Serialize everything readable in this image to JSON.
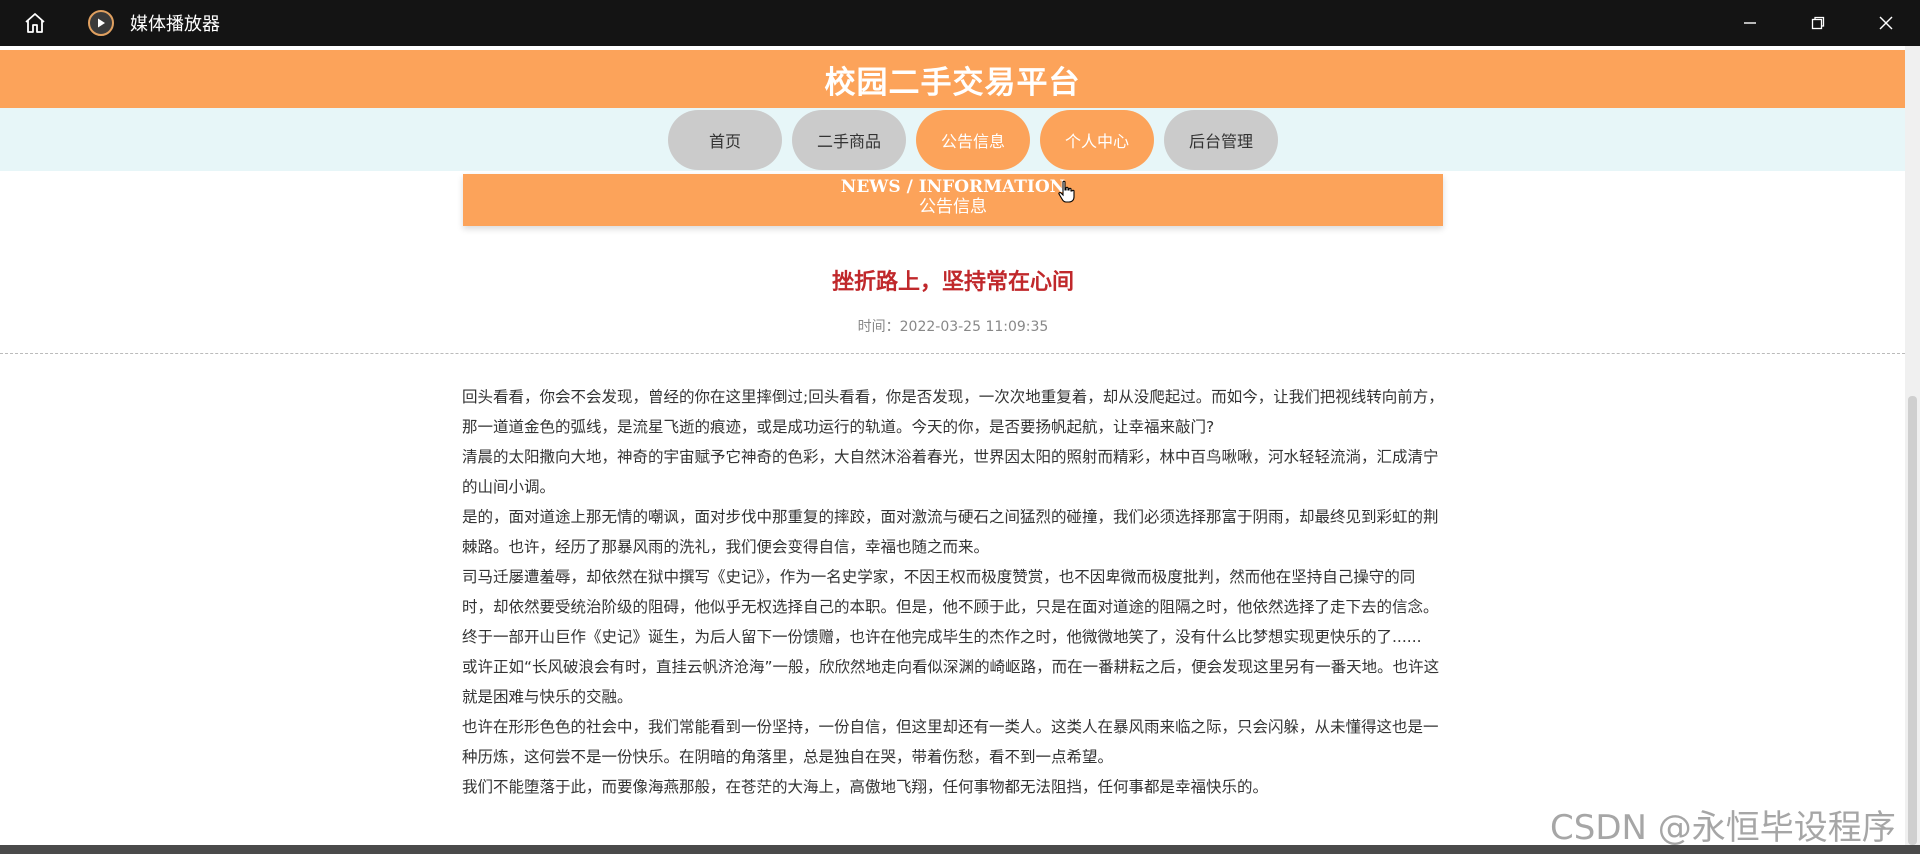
{
  "window": {
    "title": "媒体播放器",
    "icons": [
      "home-icon",
      "play-icon",
      "minimize-icon",
      "restore-icon",
      "close-icon"
    ]
  },
  "site": {
    "title": "校园二手交易平台",
    "colors": {
      "accent": "#fca35a",
      "nav_band": "#e7f6f8",
      "title_red": "#c0282b"
    }
  },
  "nav": {
    "items": [
      {
        "label": "首页",
        "active": false
      },
      {
        "label": "二手商品",
        "active": false
      },
      {
        "label": "公告信息",
        "active": true
      },
      {
        "label": "个人中心",
        "active": true
      },
      {
        "label": "后台管理",
        "active": false
      }
    ]
  },
  "banner": {
    "en": "NEWS / INFORMATION",
    "cn": "公告信息"
  },
  "article": {
    "title": "挫折路上，坚持常在心间",
    "time": "时间：2022-03-25 11:09:35",
    "paragraphs": [
      "回头看看，你会不会发现，曾经的你在这里摔倒过;回头看看，你是否发现，一次次地重复着，却从没爬起过。而如今，让我们把视线转向前方，那一道道金色的弧线，是流星飞逝的痕迹，或是成功运行的轨道。今天的你，是否要扬帆起航，让幸福来敲门?",
      "清晨的太阳撒向大地，神奇的宇宙赋予它神奇的色彩，大自然沐浴着春光，世界因太阳的照射而精彩，林中百鸟啾啾，河水轻轻流淌，汇成清宁的山间小调。",
      "是的，面对道途上那无情的嘲讽，面对步伐中那重复的摔跤，面对激流与硬石之间猛烈的碰撞，我们必须选择那富于阴雨，却最终见到彩虹的荆棘路。也许，经历了那暴风雨的洗礼，我们便会变得自信，幸福也随之而来。",
      "司马迁屡遭羞辱，却依然在狱中撰写《史记》，作为一名史学家，不因王权而极度赞赏，也不因卑微而极度批判，然而他在坚持自己操守的同时，却依然要受统治阶级的阻碍，他似乎无权选择自己的本职。但是，他不顾于此，只是在面对道途的阻隔之时，他依然选择了走下去的信念。终于一部开山巨作《史记》诞生，为后人留下一份馈赠，也许在他完成毕生的杰作之时，他微微地笑了，没有什么比梦想实现更快乐的了......",
      "或许正如“长风破浪会有时，直挂云帆济沧海”一般，欣欣然地走向看似深渊的崎岖路，而在一番耕耘之后，便会发现这里另有一番天地。也许这就是困难与快乐的交融。",
      "也许在形形色色的社会中，我们常能看到一份坚持，一份自信，但这里却还有一类人。这类人在暴风雨来临之际，只会闪躲，从未懂得这也是一种历炼，这何尝不是一份快乐。在阴暗的角落里，总是独自在哭，带着伤愁，看不到一点希望。",
      "我们不能堕落于此，而要像海燕那般，在苍茫的大海上，高傲地飞翔，任何事物都无法阻挡，任何事都是幸福快乐的。"
    ]
  },
  "watermark": "CSDN @永恒毕设程序"
}
